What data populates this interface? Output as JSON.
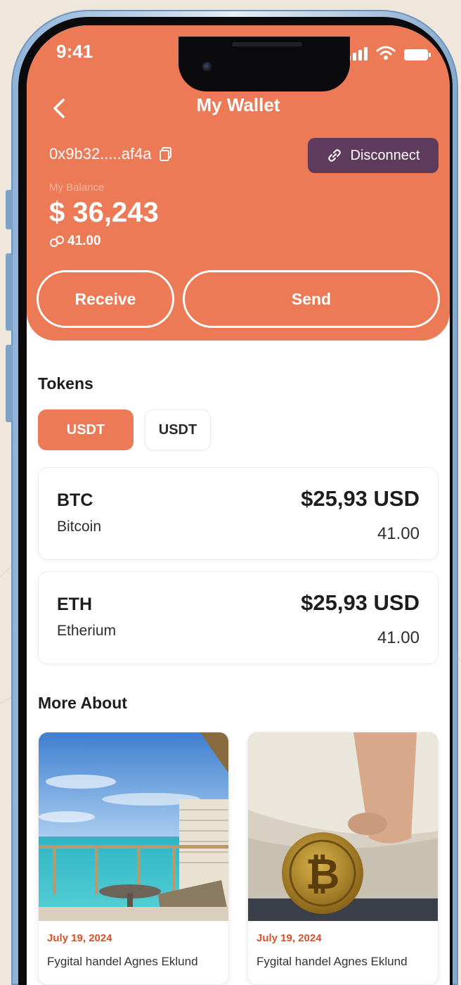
{
  "status_bar": {
    "time": "9:41"
  },
  "header": {
    "title": "My Wallet",
    "address": "0x9b32.....af4a",
    "disconnect_label": "Disconnect",
    "balance_label": "My Balance",
    "balance_value": "$ 36,243",
    "balance_sub": "41.00",
    "receive_label": "Receive",
    "send_label": "Send"
  },
  "tokens": {
    "title": "Tokens",
    "chips": [
      "USDT",
      "USDT"
    ],
    "items": [
      {
        "symbol": "BTC",
        "name": "Bitcoin",
        "usd": "$25,93 USD",
        "amount": "41.00"
      },
      {
        "symbol": "ETH",
        "name": "Etherium",
        "usd": "$25,93 USD",
        "amount": "41.00"
      }
    ]
  },
  "more_about": {
    "title": "More About",
    "articles": [
      {
        "date": "July 19, 2024",
        "title": "Fygital handel Agnes Eklund"
      },
      {
        "date": "July 19, 2024",
        "title": "Fygital handel Agnes Eklund"
      }
    ]
  },
  "colors": {
    "accent": "#ec7a57",
    "disconnect_bg": "#5e3a5c",
    "date_text": "#d9502c"
  },
  "icons": {
    "back": "chevron-left-icon",
    "copy": "copy-icon",
    "disconnect": "link-break-icon",
    "token": "chain-link-icon"
  }
}
